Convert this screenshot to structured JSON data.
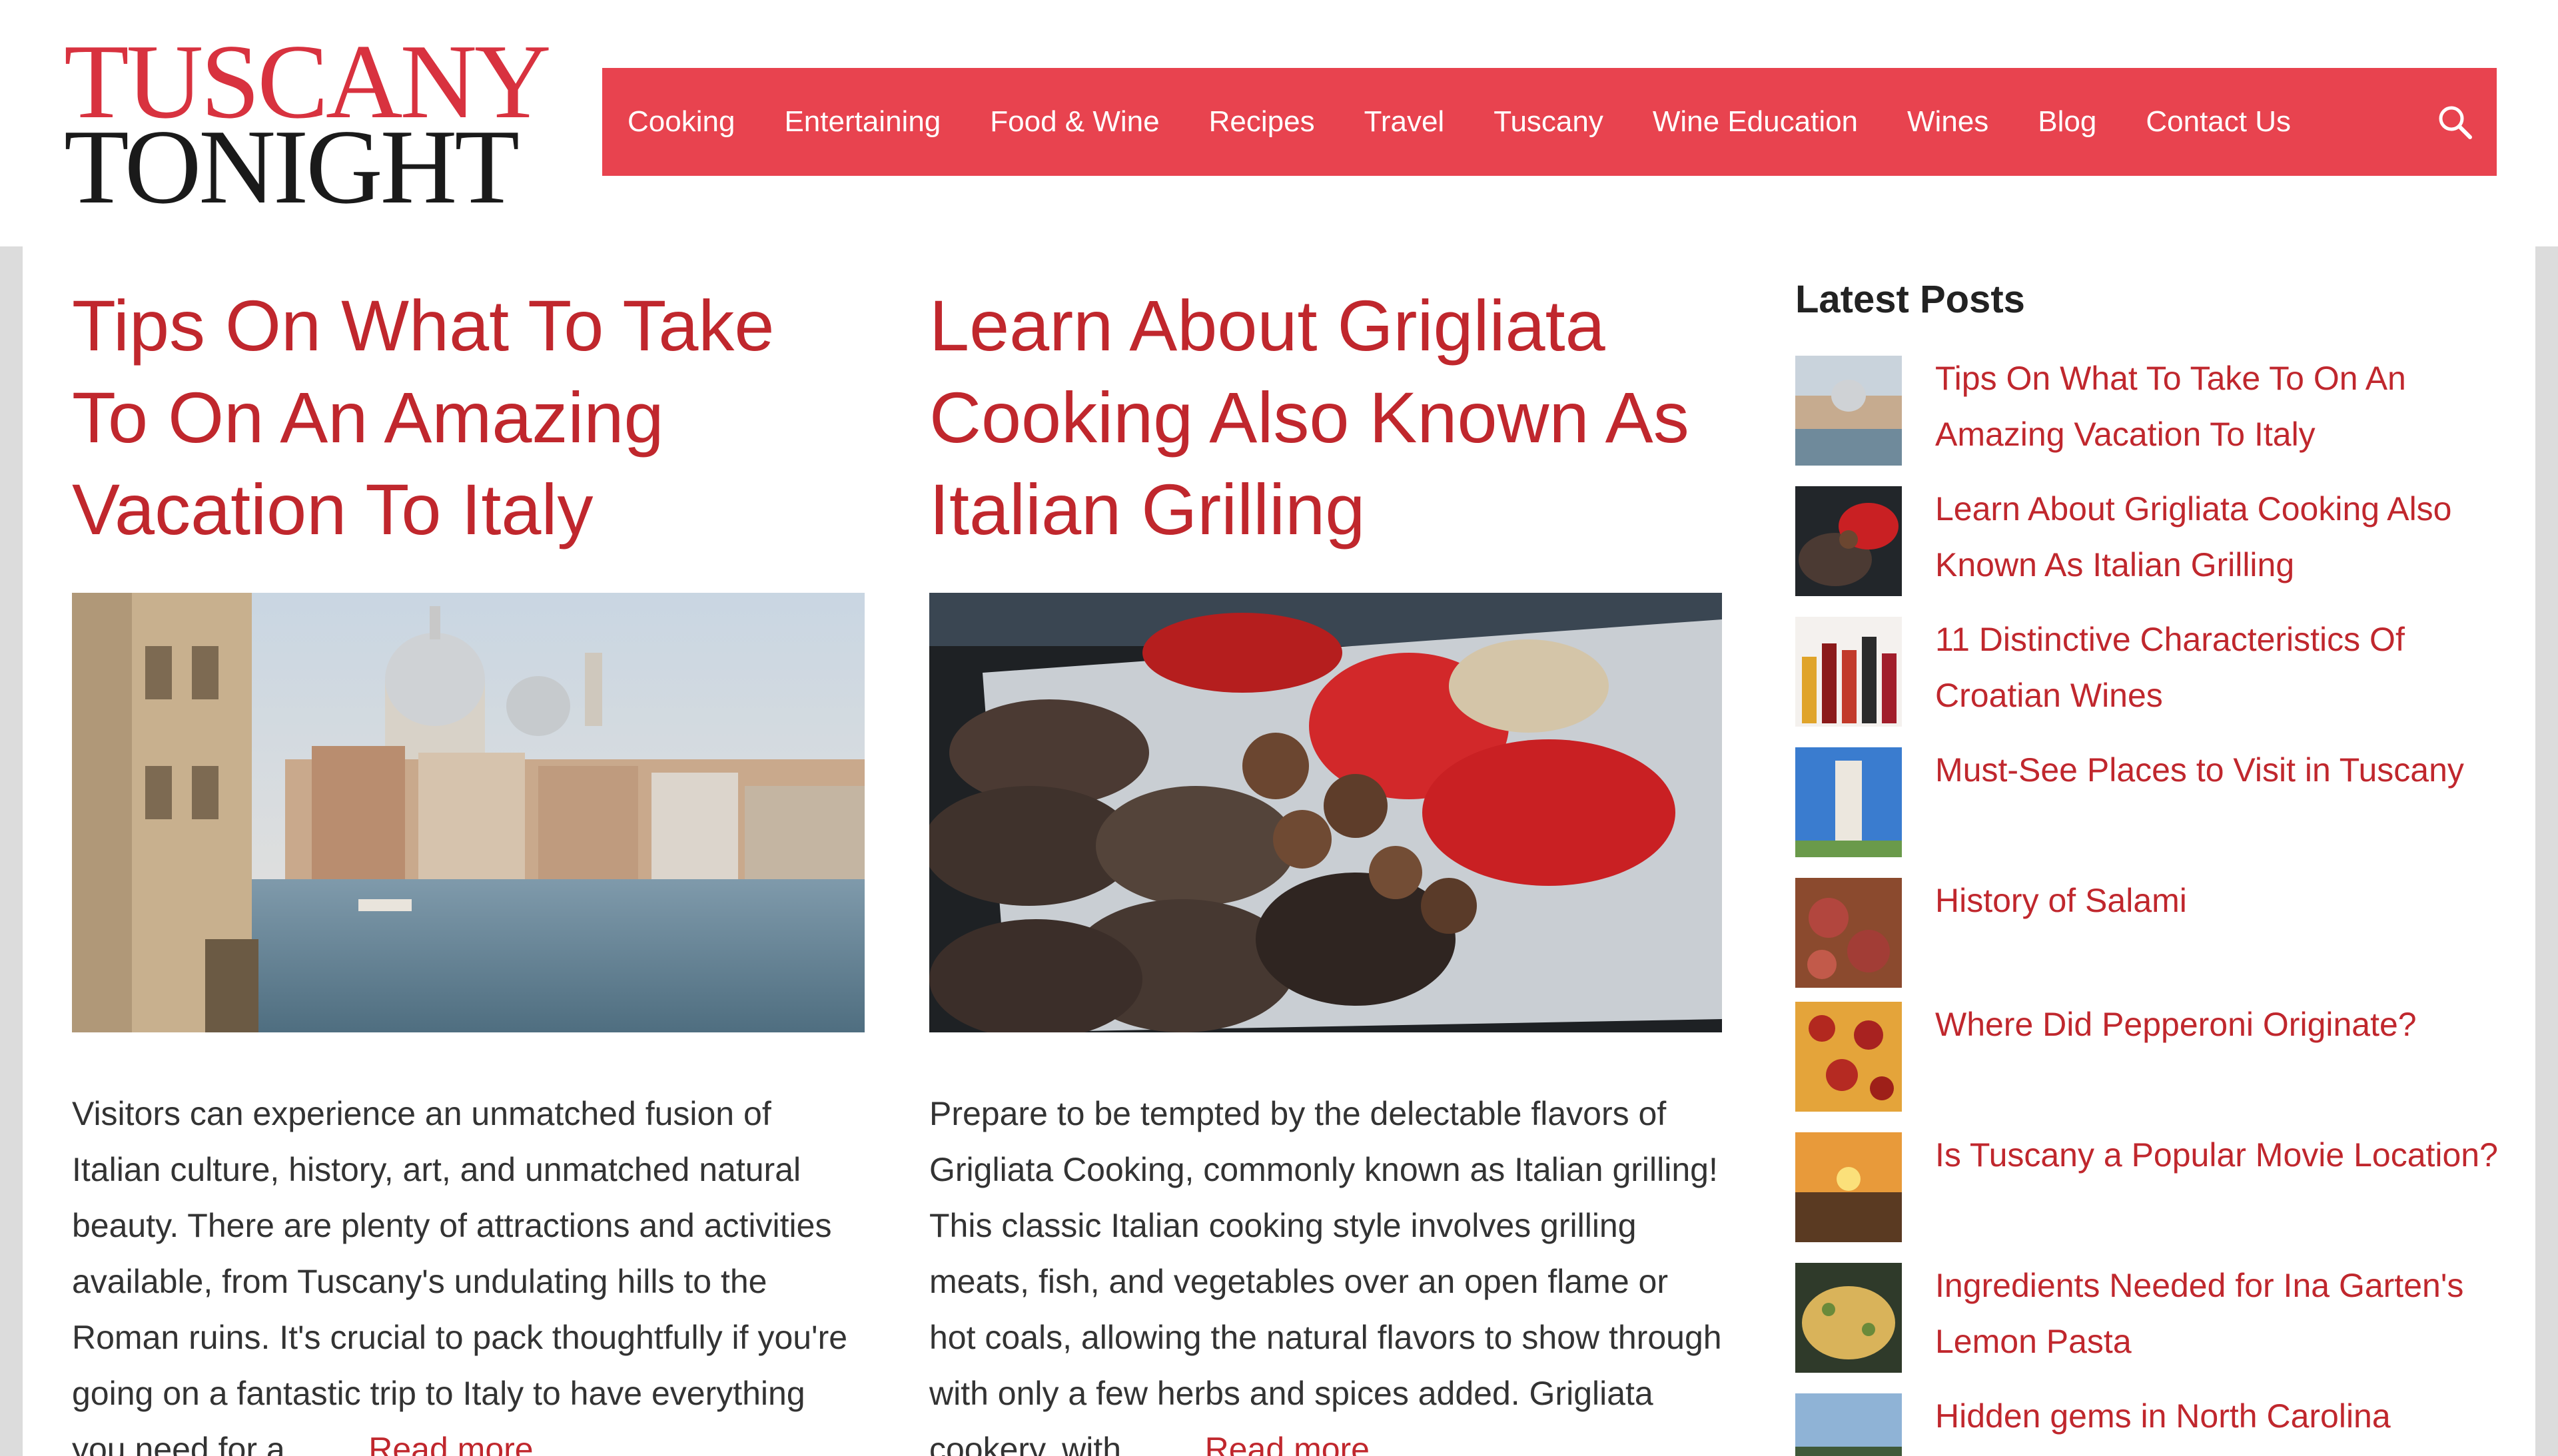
{
  "logo": {
    "line1": "TUSCANY",
    "line2": "TONIGHT"
  },
  "nav": {
    "items": [
      "Cooking",
      "Entertaining",
      "Food & Wine",
      "Recipes",
      "Travel",
      "Tuscany",
      "Wine Education",
      "Wines",
      "Blog",
      "Contact Us"
    ],
    "search_icon": "search-icon",
    "color": "#e8434f"
  },
  "posts": [
    {
      "title": "Tips On What To Take To On An Amazing Vacation To Italy",
      "image": "venice-grand-canal-photo",
      "excerpt": "Visitors can experience an unmatched fusion of Italian culture, history, art, and unmatched natural beauty. There are plenty of attractions and activities available, from Tuscany's undulating hills to the Roman ruins. It's crucial to pack thoughtfully if you're going on a fantastic trip to Italy to have everything you need for a ...",
      "read_more": "Read more"
    },
    {
      "title": "Learn About Grigliata Cooking Also Known As Italian Grilling",
      "image": "grilled-vegetables-photo",
      "excerpt": "Prepare to be tempted by the delectable flavors of Grigliata Cooking, commonly known as Italian grilling! This classic Italian cooking style involves grilling meats, fish, and vegetables over an open flame or hot coals, allowing the natural flavors to show through with only a few herbs and spices added. Grigliata cookery, with ...",
      "read_more": "Read more"
    }
  ],
  "sidebar": {
    "title": "Latest Posts",
    "items": [
      {
        "label": "Tips On What To Take To On An Amazing Vacation To Italy",
        "thumb": "venice-thumb"
      },
      {
        "label": "Learn About Grigliata Cooking Also Known As Italian Grilling",
        "thumb": "grill-thumb"
      },
      {
        "label": "11 Distinctive Characteristics Of Croatian Wines",
        "thumb": "wine-bottles-thumb"
      },
      {
        "label": "Must-See Places to Visit in Tuscany",
        "thumb": "pisa-tower-thumb"
      },
      {
        "label": "History of Salami",
        "thumb": "salami-thumb"
      },
      {
        "label": "Where Did Pepperoni Originate?",
        "thumb": "pepperoni-thumb"
      },
      {
        "label": "Is Tuscany a Popular Movie Location?",
        "thumb": "tuscany-sunset-thumb"
      },
      {
        "label": "Ingredients Needed for Ina Garten's Lemon Pasta",
        "thumb": "lemon-pasta-thumb"
      },
      {
        "label": "Hidden gems in North Carolina",
        "thumb": "north-carolina-thumb"
      }
    ]
  },
  "colors": {
    "accent": "#e8434f",
    "link": "#c0272d",
    "logo_red": "#d8323f",
    "logo_dark": "#1a1a1a"
  }
}
